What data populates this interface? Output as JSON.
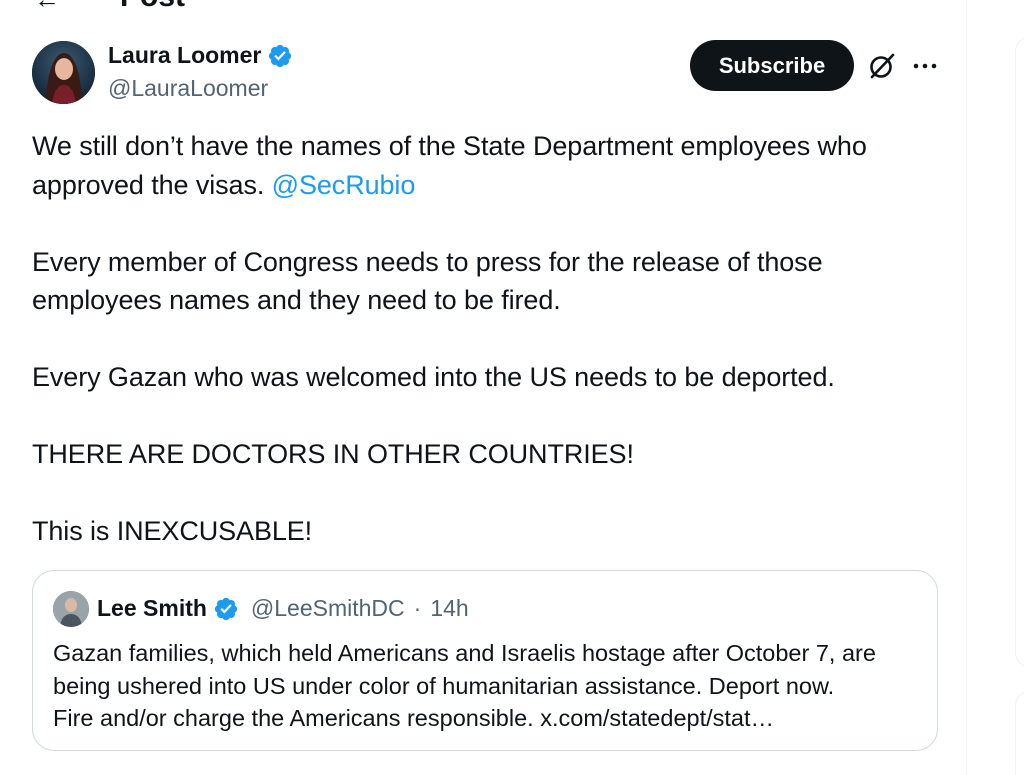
{
  "header": {
    "back_icon": "arrow-left-icon",
    "title": "Post"
  },
  "post": {
    "author_name": "Laura Loomer",
    "author_handle": "@LauraLoomer",
    "verified_icon": "verified-badge-icon",
    "subscribe_label": "Subscribe",
    "grok_icon": "grok-icon",
    "more_icon": "more-options-icon",
    "text": {
      "p1_line1": "We still don’t have the names of the State Department employees who",
      "p1_line2_prefix": "approved the visas. ",
      "p1_mention": "@SecRubio",
      "p2_line1": "Every member of Congress needs to press for the release of those",
      "p2_line2": "employees names and they need to be fired.",
      "p3": "Every Gazan who was welcomed into the US needs to be deported.",
      "p4": "THERE ARE DOCTORS IN OTHER COUNTRIES!",
      "p5": "This is INEXCUSABLE!"
    }
  },
  "quote": {
    "author_name": "Lee Smith",
    "author_handle": "@LeeSmithDC",
    "separator": "·",
    "time": "14h",
    "line1": "Gazan families, which held Americans and Israelis hostage after October 7, are",
    "line2": "being ushered into US under color of humanitarian assistance. Deport now.",
    "line3": "Fire and/or charge the Americans responsible. x.com/statedept/stat…"
  },
  "colors": {
    "accent": "#1d9bf0",
    "text": "#0f1419",
    "secondary": "#536471",
    "border": "#cfd9de",
    "button": "#0f1419"
  }
}
